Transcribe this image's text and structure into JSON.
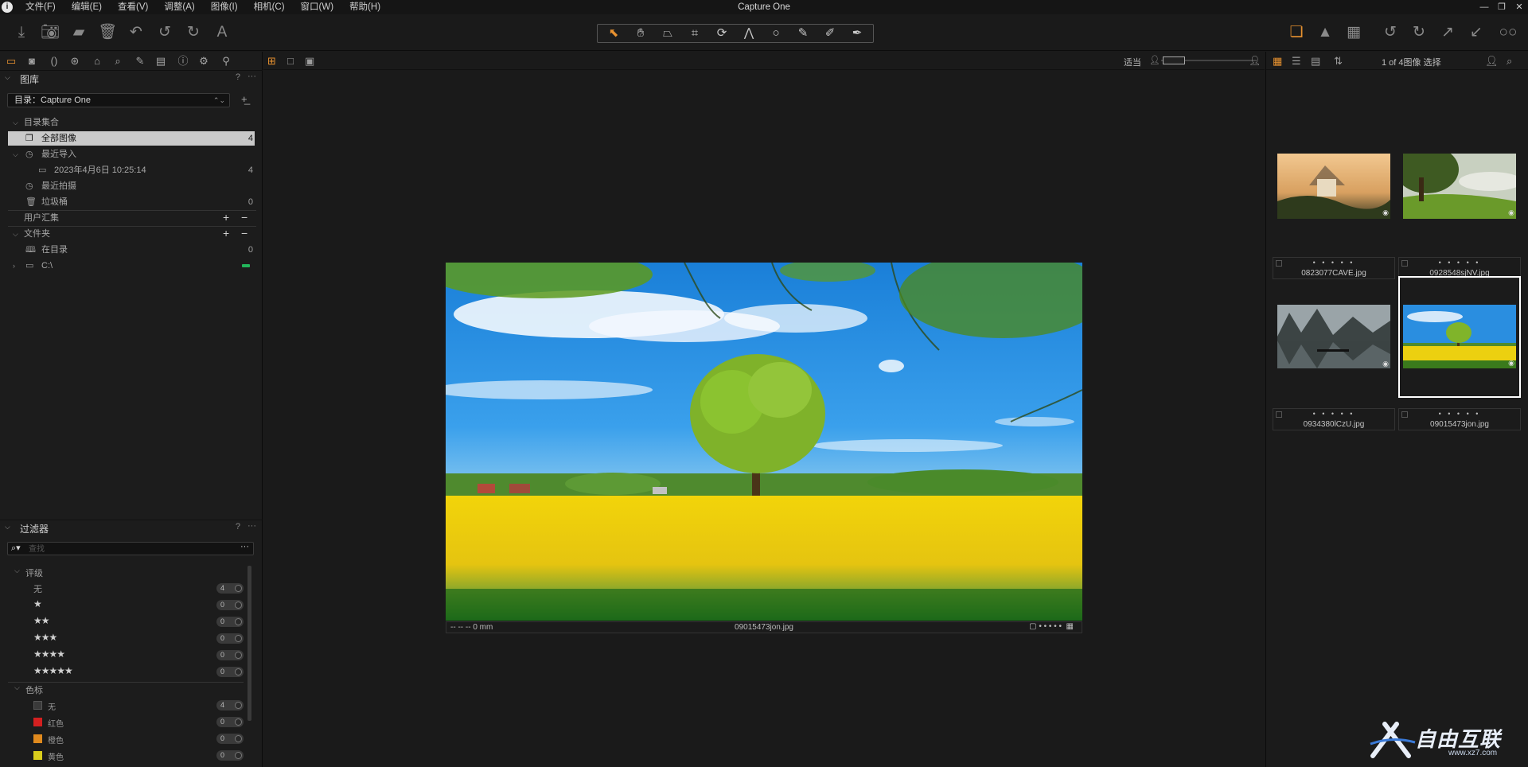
{
  "app": {
    "icon_glyph": "i",
    "title": "Capture One",
    "menu": [
      "文件(F)",
      "编辑(E)",
      "查看(V)",
      "调整(A)",
      "图像(I)",
      "相机(C)",
      "窗口(W)",
      "帮助(H)"
    ],
    "window_controls": [
      "—",
      "❐",
      "✕"
    ]
  },
  "toolbar": {
    "left_icons": [
      "import-icon",
      "camera-icon",
      "folder-icon",
      "trash-icon",
      "undo-all-icon",
      "undo-icon",
      "redo-icon",
      "text-icon"
    ],
    "cursor_tools": [
      "select-cursor-icon",
      "hand-pan-icon",
      "crop-perspective-icon",
      "crop-icon",
      "rotate-icon",
      "keystone-icon",
      "spot-icon",
      "brush-icon",
      "eraser-icon",
      "picker-icon"
    ],
    "right_icons": [
      "stack-icon",
      "warning-icon",
      "grid-icon",
      "rotate-left-icon",
      "rotate-right-icon",
      "export-icon",
      "import-arrow-icon",
      "glasses-icon"
    ]
  },
  "library_panel": {
    "title": "图库",
    "help": "?",
    "more": "···",
    "catalog_label": "目录：Capture One",
    "collections_header": "目录集合",
    "items": [
      {
        "label": "全部图像",
        "count": "4",
        "selected": true
      },
      {
        "label": "最近导入",
        "count": ""
      },
      {
        "label": "2023年4月6日 10:25:14",
        "count": "4"
      },
      {
        "label": "最近拍摄",
        "count": ""
      },
      {
        "label": "垃圾桶",
        "count": "0"
      }
    ],
    "user_collections": "用户汇集",
    "folders_header": "文件夹",
    "folder_items": [
      {
        "label": "在目录",
        "count": "0"
      },
      {
        "label": "C:\\",
        "count": ""
      }
    ]
  },
  "filters_panel": {
    "title": "过滤器",
    "help": "?",
    "more": "···",
    "search_placeholder": "查找",
    "rating_header": "评级",
    "ratings": [
      {
        "label": "无",
        "count": "4"
      },
      {
        "stars": "★",
        "count": "0"
      },
      {
        "stars": "★★",
        "count": "0"
      },
      {
        "stars": "★★★",
        "count": "0"
      },
      {
        "stars": "★★★★",
        "count": "0"
      },
      {
        "stars": "★★★★★",
        "count": "0"
      }
    ],
    "color_header": "色标",
    "colors": [
      {
        "label": "无",
        "color": "#3a3a3a",
        "count": "4"
      },
      {
        "label": "红色",
        "color": "#d42020",
        "count": "0"
      },
      {
        "label": "橙色",
        "color": "#e08a1e",
        "count": "0"
      },
      {
        "label": "黄色",
        "color": "#d8cc1c",
        "count": "0"
      }
    ]
  },
  "viewer": {
    "fit_label": "适当",
    "lens_info": "-- -- -- 0 mm",
    "filename": "09015473jon.jpg",
    "rating_dots": "• • • • •"
  },
  "browser": {
    "count_label": "1 of 4图像 选择",
    "thumbnails": [
      {
        "filename": "0823077CAVE.jpg",
        "rating": "• • • • •",
        "scene": "castle"
      },
      {
        "filename": "0928548sjNV.jpg",
        "rating": "• • • • •",
        "scene": "forest"
      },
      {
        "filename": "0934380lCzU.jpg",
        "rating": "• • • • •",
        "scene": "river"
      },
      {
        "filename": "09015473jon.jpg",
        "rating": "• • • • •",
        "scene": "field",
        "selected": true
      }
    ]
  },
  "watermark": {
    "text": "自由互联",
    "url": "www.xz7.com"
  }
}
